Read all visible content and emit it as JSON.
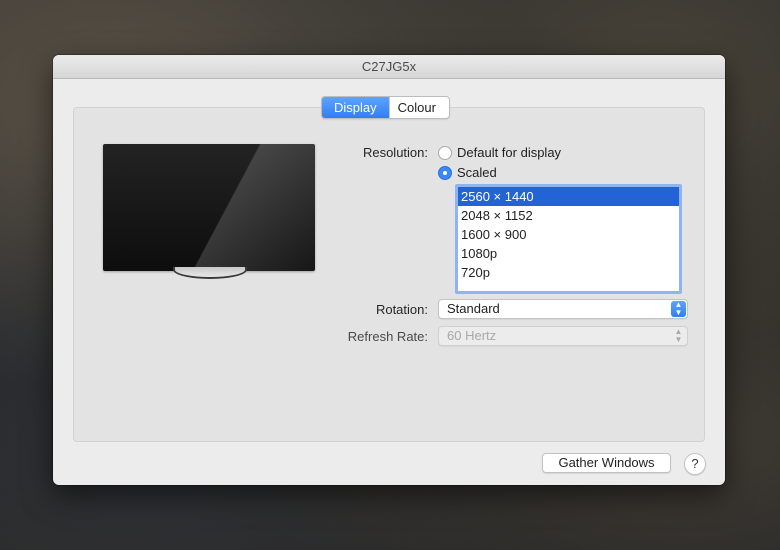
{
  "window": {
    "title": "C27JG5x"
  },
  "tabs": [
    {
      "label": "Display",
      "active": true
    },
    {
      "label": "Colour",
      "active": false
    }
  ],
  "resolution": {
    "label": "Resolution:",
    "options": [
      {
        "label": "Default for display",
        "selected": false
      },
      {
        "label": "Scaled",
        "selected": true
      }
    ],
    "scaled_list": [
      "2560 × 1440",
      "2048 × 1152",
      "1600 × 900",
      "1080p",
      "720p"
    ],
    "selected_index": 0
  },
  "rotation": {
    "label": "Rotation:",
    "value": "Standard"
  },
  "refresh_rate": {
    "label": "Refresh Rate:",
    "value": "60 Hertz",
    "enabled": false
  },
  "footer": {
    "gather_label": "Gather Windows",
    "help_label": "?"
  },
  "colors": {
    "accent": "#2f7ff5",
    "selection": "#2264d6"
  },
  "icons": {
    "monitor": "display-preview-icon",
    "stepper": "up-down-chevron-icon",
    "help": "question-mark-icon"
  }
}
